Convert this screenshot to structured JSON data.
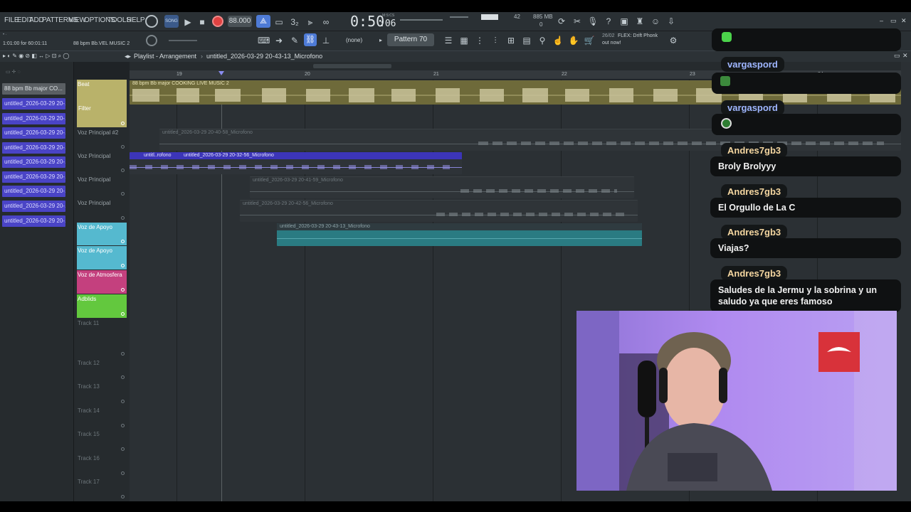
{
  "menu": [
    "FILE",
    "EDIT",
    "ADD",
    "PATTERNS",
    "VIEW",
    "OPTIONS",
    "TOOLS",
    "HELP"
  ],
  "transport": {
    "tempo": "88.000",
    "time": "0:50",
    "time_frac": ":06",
    "time_label": "M:S:CS",
    "pattern": "Pattern 70",
    "snap": "(none)",
    "cpu": "42",
    "ram": "885 MB",
    "voices": "0"
  },
  "hint": {
    "line1": "1:01:00 for 60:01:11",
    "line2": "88 bpm Bb.VEL MUSIC 2"
  },
  "news": {
    "date": "26/02",
    "title": "FLEX: Drift Phonk",
    "sub": "out now!"
  },
  "playlist": {
    "title": "Playlist - Arrangement",
    "path": "untitled_2026-03-29 20-43-13_Microfono"
  },
  "picker_items": [
    "88 bpm Bb major CO...",
    "untitled_2026-03-29 20-...",
    "untitled_2026-03-29 20-...",
    "untitled_2026-03-29 20-...",
    "untitled_2026-03-29 20-...",
    "untitled_2026-03-29 20-...",
    "untitled_2026-03-29 20-...",
    "untitled_2026-03-29 20-...",
    "untitled_2026-03-29 20-...",
    "untitled_2026-03-29 20-..."
  ],
  "ruler": [
    "19",
    "20",
    "21",
    "22",
    "23",
    "24"
  ],
  "tracks": [
    {
      "name": "Beat",
      "sub": "Filter",
      "color": "#b9b26a"
    },
    {
      "name": "Voz Principal #2",
      "color": ""
    },
    {
      "name": "Voz Principal",
      "color": ""
    },
    {
      "name": "Voz Principal",
      "color": ""
    },
    {
      "name": "Voz Principal",
      "color": ""
    },
    {
      "name": "Voz de Apoyo",
      "color": "#55b9cf"
    },
    {
      "name": "Voz de Apoyo",
      "color": "#55b9cf"
    },
    {
      "name": "Voz de Atmosfera",
      "color": "#c4407e"
    },
    {
      "name": "Adblids",
      "color": "#63c83e"
    },
    {
      "name": "Track 11",
      "color": ""
    },
    {
      "name": "Track 12",
      "color": ""
    },
    {
      "name": "Track 13",
      "color": ""
    },
    {
      "name": "Track 14",
      "color": ""
    },
    {
      "name": "Track 15",
      "color": ""
    },
    {
      "name": "Track 16",
      "color": ""
    },
    {
      "name": "Track 17",
      "color": ""
    }
  ],
  "clips": {
    "beat": "88 bpm Bb major COOKING LIVE MUSIC 2",
    "vp2": "untitled_2026-03-29 20-40-58_Microfono",
    "vp_a": "untitl..rofono",
    "vp_b": "untitled_2026-03-29 20-32-56_Microfono",
    "vp_c": "untitled_2026-03-29 20-41-59_Microfono",
    "vp_d": "untitled_2026-03-29 20-42-56_Microfono",
    "apoyo": "untitled_2026-03-29 20-43-13_Microfono"
  },
  "chat": [
    {
      "user": "vargaspord",
      "user_color": "#9fb6ff",
      "message": ""
    },
    {
      "user": "vargaspord",
      "user_color": "#9fb6ff",
      "message": ""
    },
    {
      "user": "Andres7gb3",
      "user_color": "#f4d6a0",
      "message": "Broly Brolyyy"
    },
    {
      "user": "Andres7gb3",
      "user_color": "#f4d6a0",
      "message": "El Orgullo de La C"
    },
    {
      "user": "Andres7gb3",
      "user_color": "#f4d6a0",
      "message": "Viajas?"
    },
    {
      "user": "Andres7gb3",
      "user_color": "#f4d6a0",
      "message": "Saludes de la Jermu y la sobrina y un saludo ya que eres famoso"
    }
  ],
  "colors": {
    "accent": "#4a44c6",
    "record": "#e04242",
    "beat_clip": "#6e6a3a",
    "apoyo_clip": "#2a7b82",
    "vp_clip": "#3c35b8"
  }
}
